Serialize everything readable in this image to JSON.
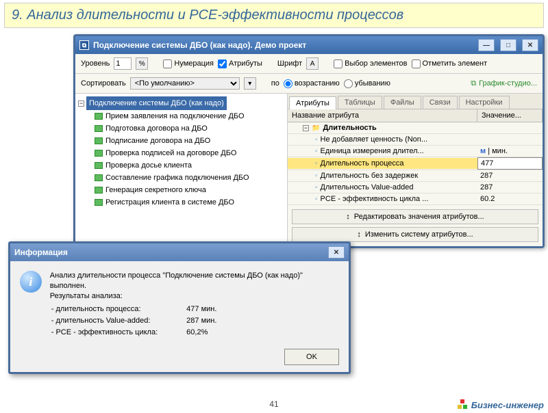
{
  "slide": {
    "title": "9. Анализ длительности и PCE-эффективности процессов",
    "page_num": "41"
  },
  "brand": {
    "text": "Бизнес-инженер"
  },
  "main_dialog": {
    "title": "Подключение системы ДБО (как надо). Демо проект",
    "toolbar1": {
      "level_label": "Уровень",
      "level_value": "1",
      "numeration_label": "Нумерация",
      "attributes_label": "Атрибуты",
      "font_label": "Шрифт",
      "select_elements_label": "Выбор элементов",
      "mark_element_label": "Отметить элемент"
    },
    "toolbar2": {
      "sort_label": "Сортировать",
      "sort_value": "<По умолчанию>",
      "po_label": "по",
      "asc_label": "возрастанию",
      "desc_label": "убыванию",
      "gs_label": "График-студио..."
    },
    "tree": {
      "root": "Подключение системы ДБО (как надо)",
      "items": [
        "Прием заявления на подключение ДБО",
        "Подготовка договора на ДБО",
        "Подписание договора на ДБО",
        "Проверка подписей на договоре ДБО",
        "Проверка досье клиента",
        "Составление графика подключения ДБО",
        "Генерация секретного ключа",
        "Регистрация клиента в системе ДБО"
      ]
    },
    "tabs": [
      "Атрибуты",
      "Таблицы",
      "Файлы",
      "Связи",
      "Настройки"
    ],
    "attr_header": {
      "name": "Название атрибута",
      "value": "Значение..."
    },
    "attrs": {
      "group": "Длительность",
      "rows": [
        {
          "name": "Не добавляет ценность (Non...",
          "value": ""
        },
        {
          "name": "Единица измерения длител...",
          "value": "мин.",
          "unit": "м"
        },
        {
          "name": "Длительность процесса",
          "value": "477",
          "sel": true
        },
        {
          "name": "Длительность без задержек",
          "value": "287"
        },
        {
          "name": "Длительность Value-added",
          "value": "287"
        },
        {
          "name": "PCE - эффективность цикла ...",
          "value": "60.2"
        }
      ]
    },
    "buttons": {
      "edit": "Редактировать значения атрибутов...",
      "change": "Изменить систему атрибутов..."
    }
  },
  "info": {
    "title": "Информация",
    "line1": "Анализ длительности процесса \"Подключение системы ДБО (как надо)\" выполнен.",
    "line2": "Результаты анализа:",
    "rows": [
      {
        "k": "- длительность процесса:",
        "v": "477 мин."
      },
      {
        "k": "- длительность Value-added:",
        "v": "287 мин."
      },
      {
        "k": "- PCE - эффективность цикла:",
        "v": "60,2%"
      }
    ],
    "ok": "OK"
  }
}
